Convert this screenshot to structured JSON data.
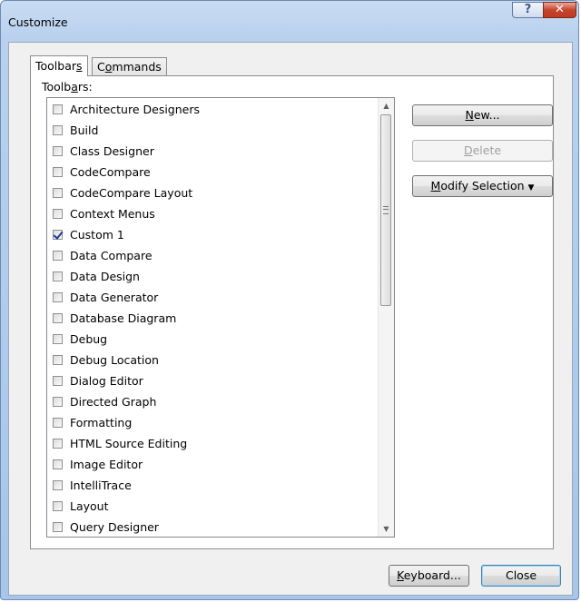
{
  "window": {
    "title": "Customize",
    "help_glyph": "?",
    "close_glyph": "✕"
  },
  "tabs": [
    {
      "label_pre": "Toolbar",
      "label_key": "s",
      "label_post": "",
      "active": true
    },
    {
      "label_pre": "C",
      "label_key": "o",
      "label_post": "mmands",
      "active": false
    }
  ],
  "list_label": {
    "pre": "Toolb",
    "key": "a",
    "post": "rs:"
  },
  "toolbars": [
    {
      "label": "Architecture Designers",
      "checked": false
    },
    {
      "label": "Build",
      "checked": false
    },
    {
      "label": "Class Designer",
      "checked": false
    },
    {
      "label": "CodeCompare",
      "checked": false
    },
    {
      "label": "CodeCompare Layout",
      "checked": false
    },
    {
      "label": "Context Menus",
      "checked": false
    },
    {
      "label": "Custom 1",
      "checked": true
    },
    {
      "label": "Data Compare",
      "checked": false
    },
    {
      "label": "Data Design",
      "checked": false
    },
    {
      "label": "Data Generator",
      "checked": false
    },
    {
      "label": "Database Diagram",
      "checked": false
    },
    {
      "label": "Debug",
      "checked": false
    },
    {
      "label": "Debug Location",
      "checked": false
    },
    {
      "label": "Dialog Editor",
      "checked": false
    },
    {
      "label": "Directed Graph",
      "checked": false
    },
    {
      "label": "Formatting",
      "checked": false
    },
    {
      "label": "HTML Source Editing",
      "checked": false
    },
    {
      "label": "Image Editor",
      "checked": false
    },
    {
      "label": "IntelliTrace",
      "checked": false
    },
    {
      "label": "Layout",
      "checked": false
    },
    {
      "label": "Query Designer",
      "checked": false
    }
  ],
  "buttons": {
    "new": {
      "key": "N",
      "rest": "ew..."
    },
    "delete": {
      "key": "D",
      "rest": "elete"
    },
    "modify": {
      "key": "M",
      "rest": "odify Selection",
      "arrow": "▼"
    },
    "keyboard": {
      "key": "K",
      "rest": "eyboard..."
    },
    "close": "Close"
  }
}
